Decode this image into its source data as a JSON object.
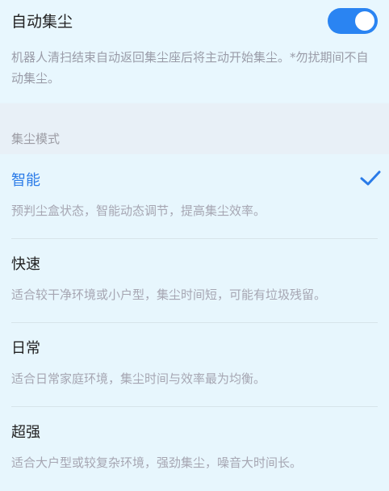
{
  "auto_dust": {
    "title": "自动集尘",
    "enabled": true,
    "description": "机器人清扫结束自动返回集尘座后将主动开始集尘。*勿扰期间不自动集尘。"
  },
  "mode_section": {
    "header": "集尘模式",
    "options": [
      {
        "label": "智能",
        "description": "预判尘盒状态，智能动态调节，提高集尘效率。",
        "selected": true
      },
      {
        "label": "快速",
        "description": "适合较干净环境或小户型，集尘时间短，可能有垃圾残留。",
        "selected": false
      },
      {
        "label": "日常",
        "description": "适合日常家庭环境，集尘时间与效率最为均衡。",
        "selected": false
      },
      {
        "label": "超强",
        "description": "适合大户型或较复杂环境，强劲集尘，噪音大时间长。",
        "selected": false
      }
    ]
  },
  "colors": {
    "accent": "#2a84f2",
    "selected_text": "#2a7be8",
    "background": "#e7f6fd"
  },
  "icons": {
    "selected": "checkmark-icon"
  }
}
